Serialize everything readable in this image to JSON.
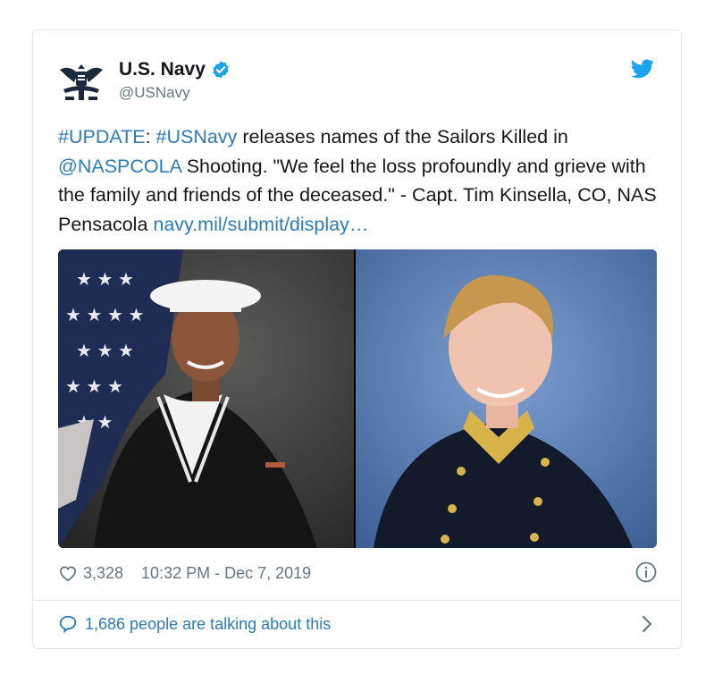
{
  "tweet": {
    "display_name": "U.S. Navy",
    "handle": "@USNavy",
    "text_parts": [
      {
        "text": "#UPDATE",
        "link": true
      },
      {
        "text": ": ",
        "link": false
      },
      {
        "text": "#USNavy",
        "link": true
      },
      {
        "text": " releases names of the Sailors Killed in ",
        "link": false
      },
      {
        "text": "@NASPCOLA",
        "link": true
      },
      {
        "text": " Shooting. \"We feel the loss profoundly and grieve with the family and friends of the deceased.\" - Capt. Tim Kinsella, CO, NAS Pensacola ",
        "link": false
      },
      {
        "text": "navy.mil/submit/display…",
        "link": true
      }
    ],
    "likes": "3,328",
    "timestamp": "10:32 PM - Dec 7, 2019",
    "talking": "1,686 people are talking about this"
  },
  "colors": {
    "link": "#2b7bb9",
    "verified": "#1da1f2",
    "muted": "#657786"
  },
  "icons": {
    "avatar": "navy-eagle-logo",
    "verified": "verified-badge-icon",
    "brand": "twitter-bird-icon",
    "like": "heart-icon",
    "info": "info-icon",
    "reply": "speech-bubble-icon",
    "more": "chevron-right-icon"
  }
}
